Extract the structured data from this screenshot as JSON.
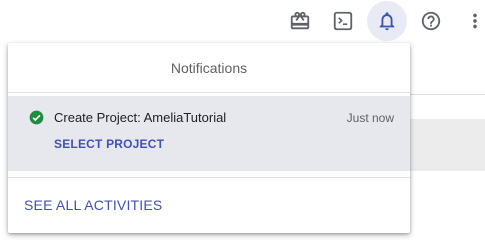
{
  "toolbar": {
    "icons": [
      "gift-icon",
      "terminal-icon",
      "notifications-bell-icon",
      "help-icon",
      "more-vert-icon"
    ],
    "active_color": "#e8eaf6",
    "icon_color": "#5f6368",
    "active_icon_color": "#3f51b5"
  },
  "notifications": {
    "title": "Notifications",
    "items": [
      {
        "status_icon": "check-circle-icon",
        "status_color": "#1e8e3e",
        "title": "Create Project: AmeliaTutorial",
        "time": "Just now",
        "action_label": "SELECT PROJECT"
      }
    ],
    "see_all_label": "SEE ALL ACTIVITIES",
    "link_color": "#3f51b5"
  }
}
